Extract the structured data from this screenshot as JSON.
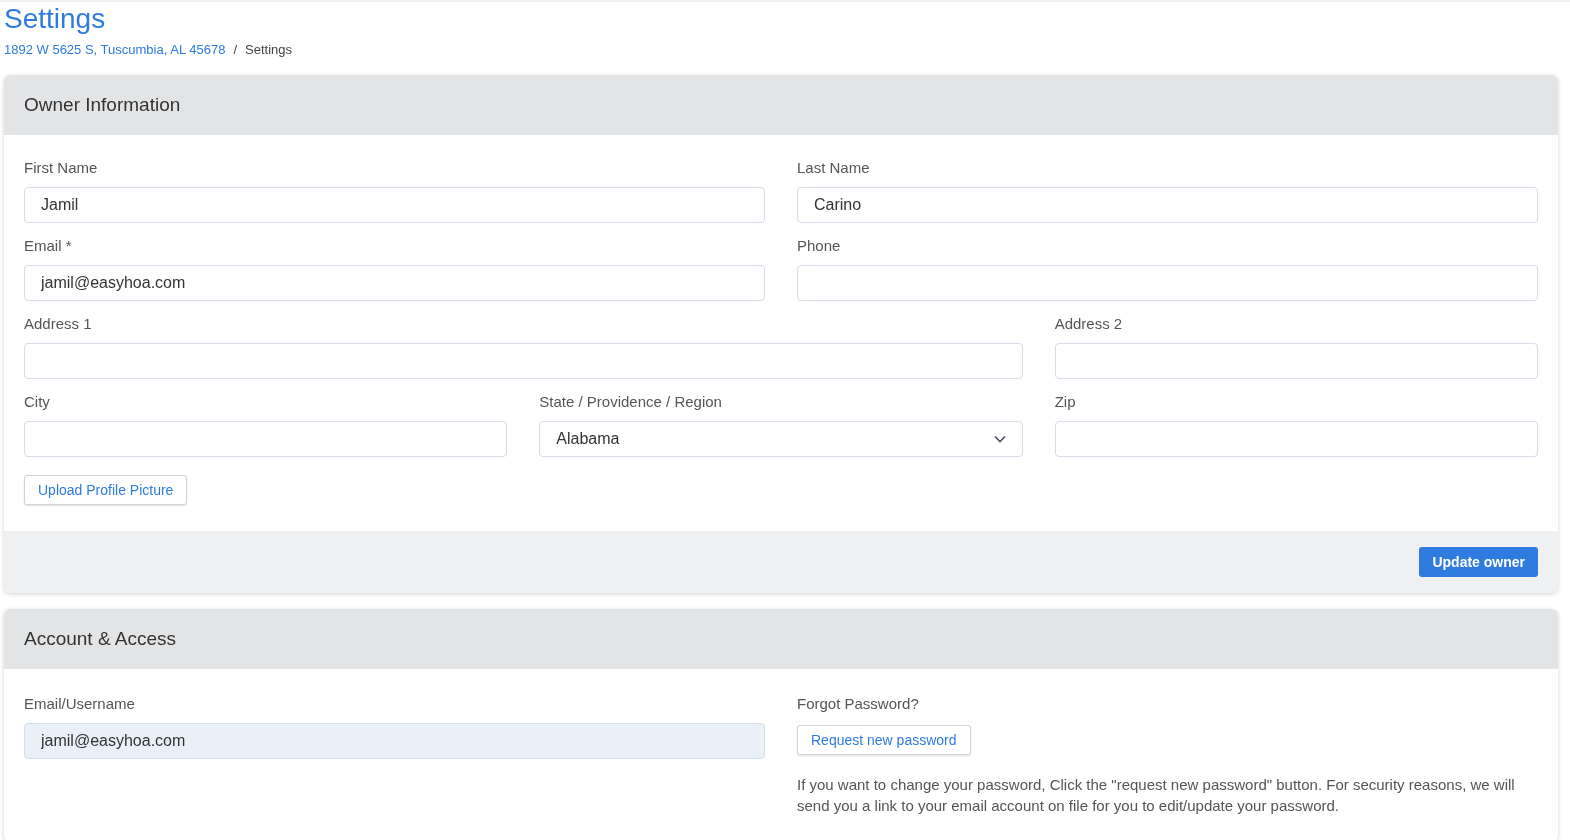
{
  "page": {
    "title": "Settings",
    "breadcrumb": [
      {
        "label": "1892 W 5625 S, Tuscumbia, AL 45678",
        "link": true
      },
      {
        "label": "Settings",
        "link": false
      }
    ],
    "separator": "/"
  },
  "owner_card": {
    "title": "Owner Information",
    "fields": [
      {
        "label": "First Name",
        "kind": "text",
        "value": "Jamil"
      },
      {
        "label": "Last Name",
        "kind": "text",
        "value": "Carino"
      },
      {
        "label": "Email *",
        "kind": "text",
        "value": "jamil@easyhoa.com"
      },
      {
        "label": "Phone",
        "kind": "text"
      },
      {
        "label": "Address 1",
        "kind": "text"
      },
      {
        "label": "Address 2",
        "kind": "text"
      },
      {
        "label": "City",
        "kind": "text"
      },
      {
        "label": "State / Providence / Region",
        "kind": "select",
        "value": "Alabama"
      },
      {
        "label": "Zip",
        "kind": "text"
      }
    ],
    "upload_button": "Upload Profile Picture",
    "submit_button": "Update owner"
  },
  "access_card": {
    "title": "Account & Access",
    "username": {
      "label": "Email/Username",
      "value": "jamil@easyhoa.com",
      "readonly": true
    },
    "forgot_label": "Forgot Password?",
    "request_button": "Request new password",
    "note": "If you want to change your password, Click the \"request new password\" button. For security reasons, we will send you a link to your email account on file for you to edit/update your password."
  }
}
